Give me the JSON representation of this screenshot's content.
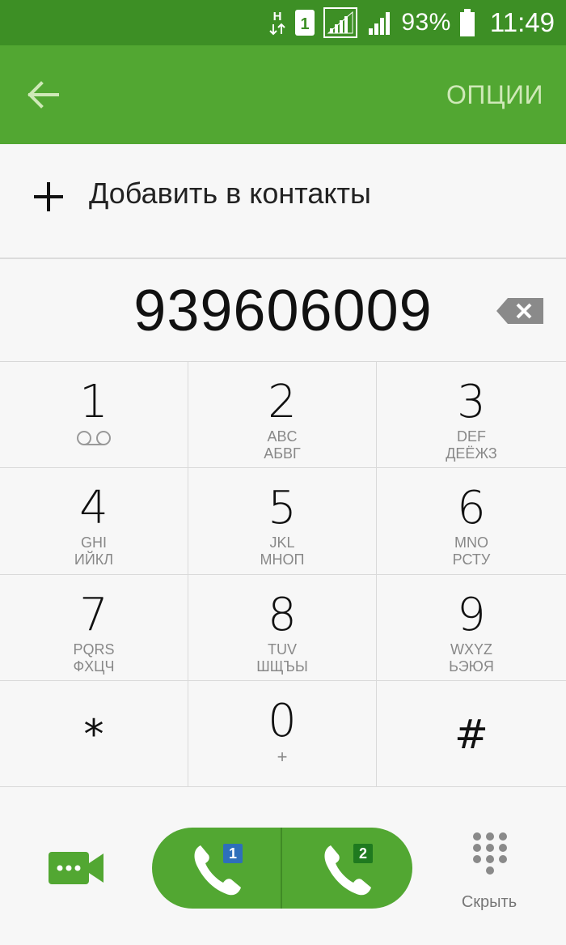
{
  "status_bar": {
    "network_type": "H",
    "sim_badge": "1",
    "battery_percent": "93%",
    "time": "11:49"
  },
  "action_bar": {
    "options_label": "ОПЦИИ"
  },
  "add_contact": {
    "label": "Добавить в контакты"
  },
  "dialed_number": "939606009",
  "keypad": {
    "keys": [
      {
        "digit": "1",
        "latin": "",
        "cyrillic": ""
      },
      {
        "digit": "2",
        "latin": "ABC",
        "cyrillic": "АБВГ"
      },
      {
        "digit": "3",
        "latin": "DEF",
        "cyrillic": "ДЕЁЖЗ"
      },
      {
        "digit": "4",
        "latin": "GHI",
        "cyrillic": "ИЙКЛ"
      },
      {
        "digit": "5",
        "latin": "JKL",
        "cyrillic": "МНОП"
      },
      {
        "digit": "6",
        "latin": "MNO",
        "cyrillic": "РСТУ"
      },
      {
        "digit": "7",
        "latin": "PQRS",
        "cyrillic": "ФХЦЧ"
      },
      {
        "digit": "8",
        "latin": "TUV",
        "cyrillic": "ШЩЪЫ"
      },
      {
        "digit": "9",
        "latin": "WXYZ",
        "cyrillic": "ЬЭЮЯ"
      },
      {
        "digit": "*",
        "latin": "",
        "cyrillic": ""
      },
      {
        "digit": "0",
        "latin": "+",
        "cyrillic": ""
      },
      {
        "digit": "#",
        "latin": "",
        "cyrillic": ""
      }
    ]
  },
  "bottom_bar": {
    "sim1_badge": "1",
    "sim2_badge": "2",
    "hide_label": "Скрыть"
  },
  "colors": {
    "status_bar": "#3d8f25",
    "action_bar": "#52a732",
    "accent_green": "#52a732",
    "sim1_blue": "#2e6fba",
    "sim2_green": "#1f7a1f"
  }
}
